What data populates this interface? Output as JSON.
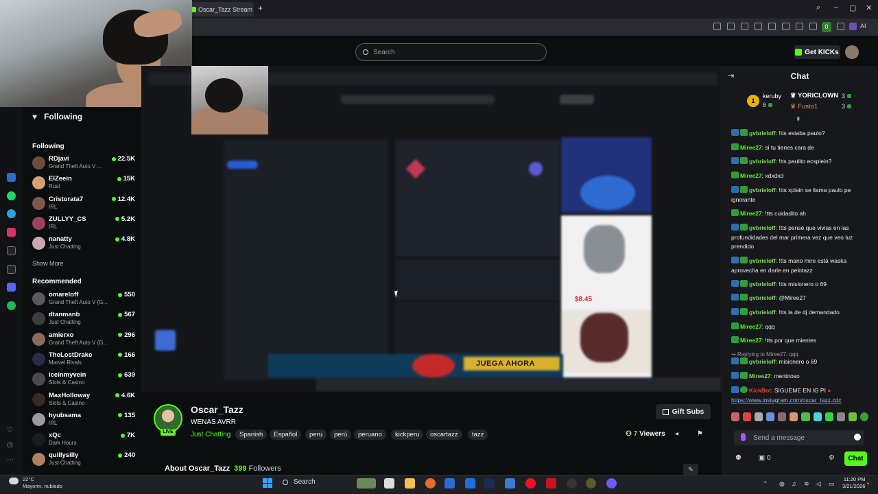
{
  "browser": {
    "tab_title": "Oscar_Tazz Stream - V",
    "tab_close": "×",
    "new_tab": "+",
    "ai_label": "AI",
    "badge_count": "0"
  },
  "header": {
    "search_placeholder": "Search",
    "get_kicks": "Get KICKs"
  },
  "sidebar": {
    "following_header": "Following",
    "following_section": "Following",
    "following": [
      {
        "name": "RDjavi",
        "category": "Grand Theft Auto V ...",
        "viewers": "22.5K",
        "color": "#6b4f3b"
      },
      {
        "name": "ElZeein",
        "category": "Rust",
        "viewers": "15K",
        "color": "#d8a070"
      },
      {
        "name": "Cristorata7",
        "category": "IRL",
        "viewers": "12.4K",
        "color": "#7a5a4a"
      },
      {
        "name": "ZULLYY_CS",
        "category": "IRL",
        "viewers": "5.2K",
        "color": "#a04060"
      },
      {
        "name": "nanatty",
        "category": "Just Chatting",
        "viewers": "4.8K",
        "color": "#c9a6b6"
      }
    ],
    "show_more": "Show More",
    "recommended_section": "Recommended",
    "recommended": [
      {
        "name": "omareloff",
        "category": "Grand Theft Auto V (G...",
        "viewers": "550",
        "color": "#5b5b5b"
      },
      {
        "name": "dtanmanb",
        "category": "Just Chatting",
        "viewers": "567",
        "color": "#3d3d3d"
      },
      {
        "name": "amierxo",
        "category": "Grand Theft Auto V (G...",
        "viewers": "296",
        "color": "#8a6b5b"
      },
      {
        "name": "TheLostDrake",
        "category": "Marvel Rivals",
        "viewers": "166",
        "color": "#2a2a4a"
      },
      {
        "name": "iceinmyvein",
        "category": "Slots & Casino",
        "viewers": "639",
        "color": "#4a4a4a"
      },
      {
        "name": "MaxHolloway",
        "category": "Slots & Casino",
        "viewers": "4.6K",
        "color": "#3a2a22"
      },
      {
        "name": "hyubsama",
        "category": "IRL",
        "viewers": "135",
        "color": "#9a9a9a"
      },
      {
        "name": "xQc",
        "category": "Dark Hours",
        "viewers": "7K",
        "color": "#1a1a1a"
      },
      {
        "name": "quillysilly",
        "category": "Just Chatting",
        "viewers": "240",
        "color": "#b08060"
      }
    ]
  },
  "stream": {
    "channel_name": "Oscar_Tazz",
    "title": "WENAS AVRR",
    "category": "Just Chatting",
    "live_badge": "LIVE",
    "tags": [
      "Spanish",
      "Español",
      "peru",
      "perú",
      "peruano",
      "kickperu",
      "oscartazz",
      "tazz"
    ],
    "gift_subs": "Gift Subs",
    "viewers_count": "7",
    "viewers_label": "Viewers",
    "about_label": "About Oscar_Tazz",
    "followers_count": "399",
    "followers_label": "Followers"
  },
  "video_content": {
    "ad_text": "JUEGA AHORA",
    "ad_price": "$8.45"
  },
  "chat": {
    "title": "Chat",
    "leaderboard": {
      "first_rank": "1",
      "first_name": "keruby",
      "first_count": "6",
      "second_name": "YORICLOWN",
      "second_count": "3",
      "third_name": "Fusto1",
      "third_count": "3"
    },
    "messages": [
      {
        "user": "gvbrieloff",
        "text": "!tts estaba paulo?",
        "badge": "blue"
      },
      {
        "user": "Miree27",
        "text": "si tu tienes cara de",
        "badge": "green"
      },
      {
        "user": "gvbrieloff",
        "text": "!tts paulito ecsplein?",
        "badge": "blue"
      },
      {
        "user": "Miree27",
        "text": "xdxdxd",
        "badge": "green"
      },
      {
        "user": "gvbrieloff",
        "text": "!tts xplain se llama paulo pe ignorante",
        "badge": "blue"
      },
      {
        "user": "Miree27",
        "text": "!tts cuidadito ah",
        "badge": "green"
      },
      {
        "user": "gvbrieloff",
        "text": "!tts pensé que vivias en las profundidades del mar primera vez que veo luz prendido",
        "badge": "blue"
      },
      {
        "user": "gvbrieloff",
        "text": "!tts mano mire está waska aprovecha en darle en pelotazz",
        "badge": "blue"
      },
      {
        "user": "gvbrieloff",
        "text": "!tts misionero o 69",
        "badge": "blue"
      },
      {
        "user": "gvbrieloff",
        "text": "@Miree27",
        "badge": "blue"
      },
      {
        "user": "gvbrieloff",
        "text": "!tts la de dj demandado",
        "badge": "blue"
      },
      {
        "user": "Miree27",
        "text": "qqq",
        "badge": "green"
      },
      {
        "user": "Miree27",
        "text": "!tts por que mientes",
        "badge": "green"
      }
    ],
    "reply_note": "Replying to Miree27: qqq",
    "reply_msg": {
      "user": "gvbrieloff",
      "text": "misionero o 69"
    },
    "after_reply": {
      "user": "Miree27",
      "text": "mentiroso"
    },
    "kickbot": {
      "user": "KickBot",
      "text": "SIGUEME EN IG PI",
      "link": "https://www.instagram.com/oscar_tazz.cdc"
    },
    "send_placeholder": "Send a message",
    "kicks_count": "0",
    "chat_button": "Chat"
  },
  "taskbar": {
    "temp": "22°C",
    "weather": "Mayorm. nublado",
    "search": "Search",
    "time": "11:20 PM",
    "date": "3/21/2026"
  }
}
